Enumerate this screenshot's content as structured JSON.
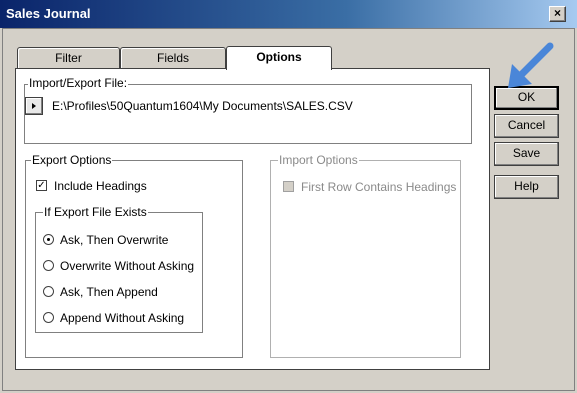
{
  "window": {
    "title": "Sales Journal",
    "close_glyph": "×"
  },
  "tabs": [
    {
      "label": "Filter",
      "active": false
    },
    {
      "label": "Fields",
      "active": false
    },
    {
      "label": "Options",
      "active": true
    }
  ],
  "import_export": {
    "legend": "Import/Export File:",
    "browse_icon": "triangle-right-icon",
    "path": "E:\\Profiles\\50Quantum1604\\My Documents\\SALES.CSV"
  },
  "export_options": {
    "legend": "Export Options",
    "include_headings": {
      "label": "Include Headings",
      "checked": true,
      "mark": "✓"
    },
    "if_exists": {
      "legend": "If Export File Exists",
      "options": [
        {
          "label": "Ask, Then Overwrite",
          "selected": true
        },
        {
          "label": "Overwrite Without Asking",
          "selected": false
        },
        {
          "label": "Ask, Then Append",
          "selected": false
        },
        {
          "label": "Append Without Asking",
          "selected": false
        }
      ]
    }
  },
  "import_options": {
    "legend": "Import Options",
    "first_row": {
      "label": "First Row Contains Headings",
      "checked": false,
      "disabled": true
    }
  },
  "buttons": {
    "ok": "OK",
    "cancel": "Cancel",
    "save": "Save",
    "help": "Help"
  },
  "annotation": {
    "arrow_icon": "pointer-arrow-icon",
    "arrow_color": "#4a86d8"
  }
}
